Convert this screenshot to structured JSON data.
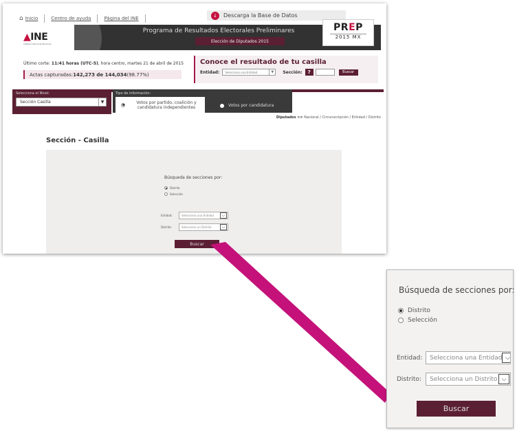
{
  "top_nav": {
    "home": "Inicio",
    "help": "Centro de ayuda",
    "ine_page": "Página del INE"
  },
  "download": {
    "label": "Descarga la Base de Datos",
    "icon": "download-icon"
  },
  "banner": {
    "logo": "INE",
    "logo_sub": "Instituto Nacional Electoral",
    "title": "Programa de Resultados Electorales Preliminares",
    "subtitle": "Elección de Diputados  2015",
    "prep_logo": "PREP",
    "prep_year": "2015 MX"
  },
  "status": {
    "cut_prefix": "Último corte: ",
    "cut_time": "11:41 horas (UTC-5)",
    "cut_suffix": ", hora centro, martes 21 de abril de 2015",
    "actas_label": "Actas capturadas: ",
    "actas_value": "142,273 de 144,034",
    "actas_pct": " (98.77%)"
  },
  "casilla_box": {
    "title": "Conoce el resultado de tu casilla",
    "entidad_label": "Entidad:",
    "entidad_placeholder": "Selecciona una Entidad",
    "seccion_label": "Sección:",
    "help_label": "?",
    "search_button": "Buscar"
  },
  "level": {
    "label": "Selecciona el Nivel:",
    "selected": "Sección Casilla"
  },
  "info_type": {
    "label": "Tipo de información:",
    "tab_party": "Votos por partido, coalición y candidatura independientes",
    "tab_candidate": "Votos por candidatura"
  },
  "breadcrumb": {
    "bold": "Diputados",
    "sep": ">>",
    "path": "Nacional / Circunscripción / Entidad / Distrito"
  },
  "section": {
    "title": "Sección - Casilla",
    "search_heading": "Búsqueda de secciones por:",
    "option_distrito": "Distrito",
    "option_seleccion": "Selección",
    "entidad_label": "Entidad:",
    "entidad_placeholder": "Selecciona una Entidad",
    "distrito_label": "Distrito:",
    "distrito_placeholder": "Selecciona un Distrito",
    "search_button": "Buscar"
  },
  "colors": {
    "accent": "#5b1f34",
    "callout": "#c4127a",
    "banner": "#323232"
  }
}
